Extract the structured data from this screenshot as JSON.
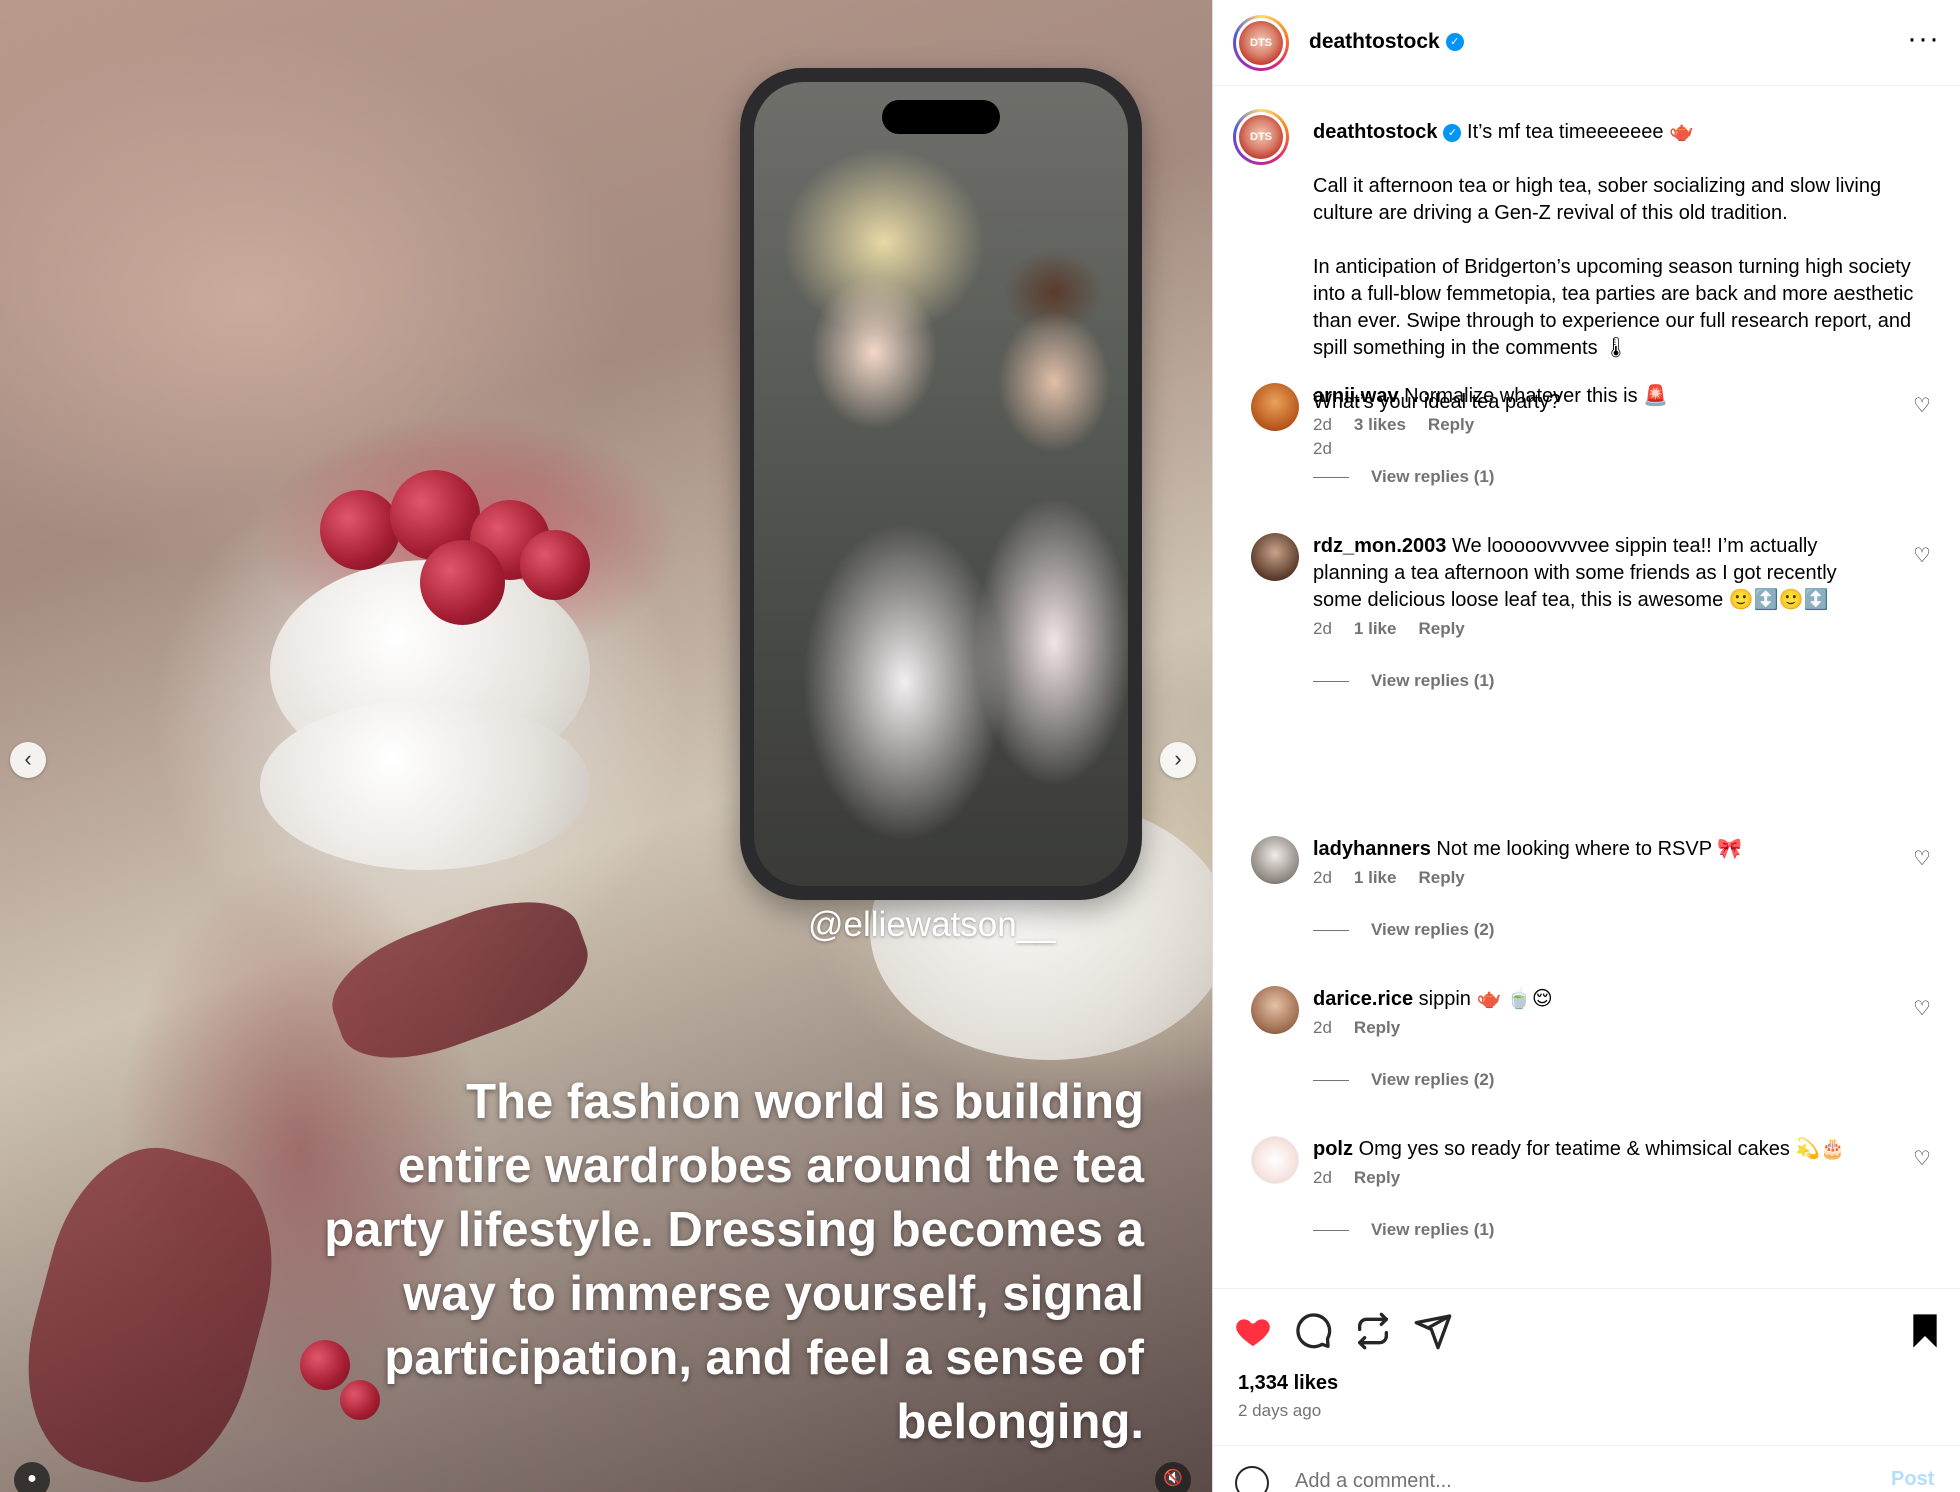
{
  "media": {
    "watermark_handle": "@elliewatson__",
    "overlay_caption": "The fashion world is building entire wardrobes around the tea party lifestyle. Dressing becomes a way to immerse yourself, signal participation, and feel a sense of belonging.",
    "prev_icon": "chevron-left-icon",
    "next_icon": "chevron-right-icon",
    "mute_icon": "speaker-muted-icon",
    "tag_icon": "user-tag-icon"
  },
  "header": {
    "username": "deathtostock",
    "avatar_text": "DTS",
    "verified": true
  },
  "caption": {
    "username": "deathtostock",
    "first_line": "It’s mf tea timeeeeeee 🫖",
    "paragraphs": [
      "Call it afternoon tea or high tea, sober socializing and slow living culture are driving a Gen-Z revival of this old tradition.",
      "In anticipation of Bridgerton’s upcoming season turning high society into a full-blow femmetopia, tea parties are back and more aesthetic than ever. Swipe through to experience our full research report, and spill something in the comments 🌡",
      "What’s your ideal tea party?"
    ],
    "time": "2d"
  },
  "comments": [
    {
      "username": "arnii.wav",
      "text": "Normalize whatever this is 🚨",
      "time": "2d",
      "likes": "3 likes",
      "reply": "Reply",
      "view_replies": "View replies (1)"
    },
    {
      "username": "rdz_mon.2003",
      "text": "We looooovvvvee sippin tea!! I’m actually planning a tea afternoon with some friends as I got recently some delicious loose leaf tea, this is awesome 🙂↕️🙂↕️",
      "time": "2d",
      "likes": "1 like",
      "reply": "Reply",
      "view_replies": "View replies (1)"
    },
    {
      "username": "ladyhanners",
      "text": "Not me looking where to RSVP 🎀",
      "time": "2d",
      "likes": "1 like",
      "reply": "Reply",
      "view_replies": "View replies (2)"
    },
    {
      "username": "darice.rice",
      "text": "sippin 🫖 🍵😌",
      "time": "2d",
      "likes": "",
      "reply": "Reply",
      "view_replies": "View replies (2)"
    },
    {
      "username": "polz",
      "text": "Omg yes so ready for teatime & whimsical cakes 💫🎂",
      "time": "2d",
      "likes": "",
      "reply": "Reply",
      "view_replies": "View replies (1)"
    }
  ],
  "actions": {
    "like_icon": "heart-filled-icon",
    "comment_icon": "comment-icon",
    "repost_icon": "repost-icon",
    "share_icon": "share-icon",
    "save_icon": "bookmark-filled-icon",
    "likes_count": "1,334 likes",
    "date": "2 days ago",
    "like_color": "#ff3040"
  },
  "comment_bar": {
    "placeholder": "Add a comment...",
    "post_label": "Post"
  }
}
